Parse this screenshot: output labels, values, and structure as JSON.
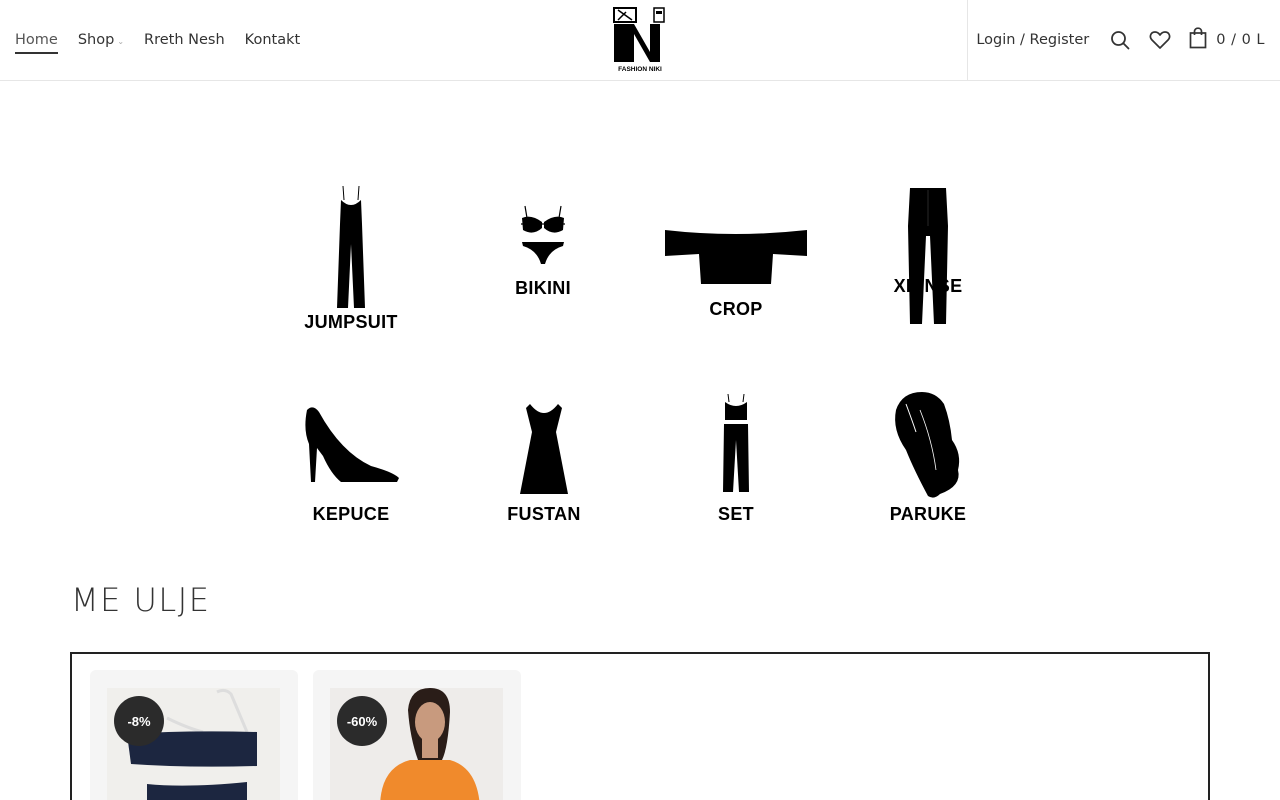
{
  "nav": {
    "items": [
      {
        "label": "Home",
        "active": true
      },
      {
        "label": "Shop",
        "dropdown": true
      },
      {
        "label": "Rreth Nesh"
      },
      {
        "label": "Kontakt"
      }
    ]
  },
  "logo": {
    "brand_text": "FASHION NIKI",
    "letter": "N"
  },
  "header_right": {
    "login_label": "Login / Register",
    "cart_text": "0 / 0 L",
    "icons": [
      "search-icon",
      "heart-icon",
      "shopping-bag-icon"
    ]
  },
  "categories": [
    {
      "label": "JUMPSUIT",
      "icon": "jumpsuit-icon"
    },
    {
      "label": "BIKINI",
      "icon": "bikini-icon"
    },
    {
      "label": "CROP",
      "icon": "crop-top-icon"
    },
    {
      "label": "XHINSE",
      "icon": "jeans-icon"
    },
    {
      "label": "KEPUCE",
      "icon": "high-heel-icon"
    },
    {
      "label": "FUSTAN",
      "icon": "dress-icon"
    },
    {
      "label": "SET",
      "icon": "set-icon"
    },
    {
      "label": "PARUKE",
      "icon": "wig-icon"
    }
  ],
  "sale_section": {
    "title": "ME ULJE",
    "products": [
      {
        "badge": "-8%"
      },
      {
        "badge": "-60%"
      }
    ]
  },
  "colors": {
    "badge_bg": "#2b2b2b",
    "text": "#333333",
    "border": "#e6e6e6"
  }
}
